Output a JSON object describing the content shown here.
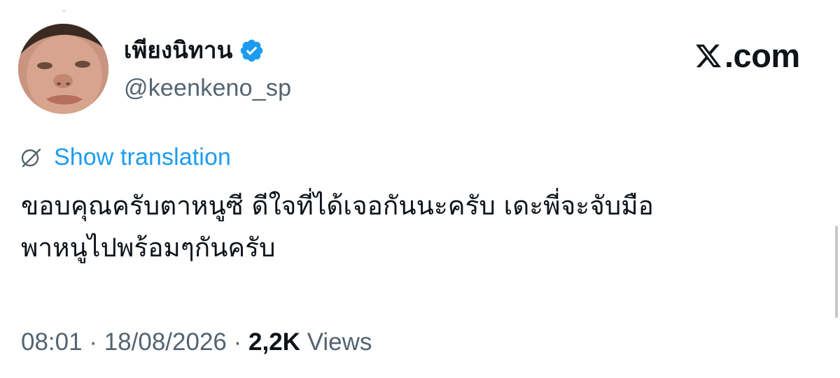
{
  "author": {
    "display_name": "เพียงนิทาน",
    "handle": "@keenkeno_sp",
    "verified": true,
    "avatar_icon": "profile-photo"
  },
  "brand": {
    "logo_icon": "x-logo-icon",
    "domain_text": ".com"
  },
  "translation": {
    "icon": "globe-icon",
    "label": "Show translation"
  },
  "tweet": {
    "text": "ขอบคุณครับตาหนูซี ดีใจที่ได้เจอกันนะครับ เดะพี่จะจับมือ\nพาหนูไปพร้อมๆกันครับ"
  },
  "meta": {
    "time": "08:01",
    "date": "18/08/2026",
    "separator": "·",
    "views_count": "2,2K",
    "views_label": "Views"
  },
  "colors": {
    "accent": "#1d9bf0",
    "text_primary": "#0f1419",
    "text_secondary": "#536471",
    "background": "#ffffff"
  }
}
